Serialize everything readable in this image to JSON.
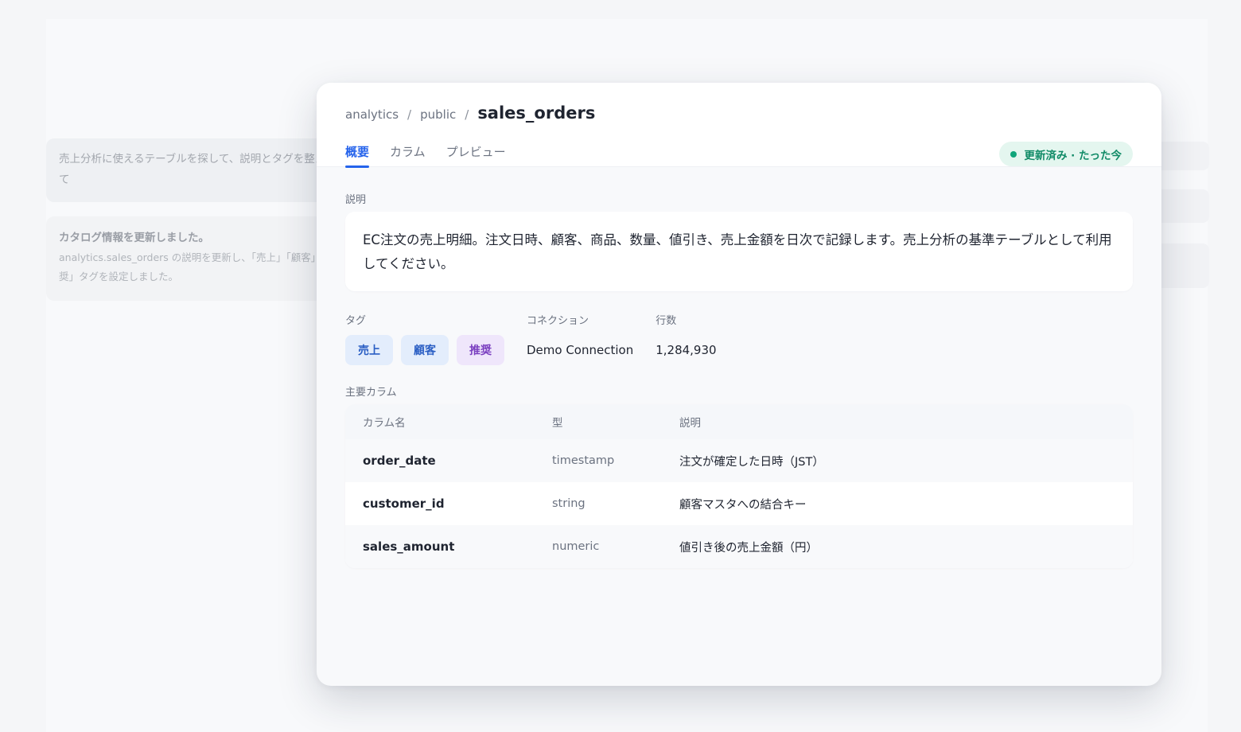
{
  "background": {
    "user_message": "売上分析に使えるテーブルを探して、説明とタグを整えて",
    "assistant_message": {
      "title": "カタログ情報を更新しました。",
      "body": "analytics.sales_orders の説明を更新し、「売上」「顧客」「推奨」タグを設定しました。"
    }
  },
  "modal": {
    "breadcrumb": {
      "database": "analytics",
      "schema": "public",
      "table": "sales_orders",
      "separator": "/"
    },
    "tabs": [
      {
        "label": "概要",
        "active": true
      },
      {
        "label": "カラム",
        "active": false
      },
      {
        "label": "プレビュー",
        "active": false
      }
    ],
    "status": {
      "text": "更新済み · たった今",
      "color": "#10a57a"
    },
    "description": {
      "label": "説明",
      "text": "EC注文の売上明細。注文日時、顧客、商品、数量、値引き、売上金額を日次で記録します。売上分析の基準テーブルとして利用してください。"
    },
    "tags": {
      "label": "タグ",
      "items": [
        {
          "label": "売上",
          "color": "blue"
        },
        {
          "label": "顧客",
          "color": "blue"
        },
        {
          "label": "推奨",
          "color": "violet"
        }
      ]
    },
    "connection": {
      "label": "コネクション",
      "value": "Demo Connection"
    },
    "row_count": {
      "label": "行数",
      "value": "1,284,930"
    },
    "key_columns": {
      "label": "主要カラム",
      "headers": {
        "name": "カラム名",
        "type": "型",
        "description": "説明"
      },
      "rows": [
        {
          "name": "order_date",
          "type": "timestamp",
          "description": "注文が確定した日時（JST）"
        },
        {
          "name": "customer_id",
          "type": "string",
          "description": "顧客マスタへの結合キー"
        },
        {
          "name": "sales_amount",
          "type": "numeric",
          "description": "値引き後の売上金額（円）"
        }
      ]
    }
  },
  "colors": {
    "accent": "#2563eb",
    "success": "#10a57a",
    "tag_blue": "#2b5fc4",
    "tag_violet": "#7a3fc0"
  }
}
